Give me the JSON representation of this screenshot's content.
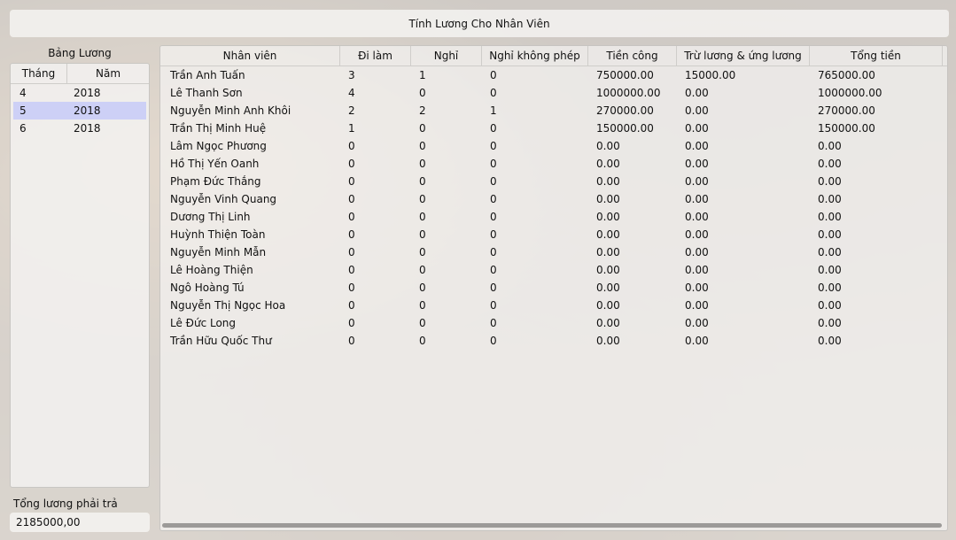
{
  "window": {
    "title": "Tính Lương Cho Nhân Viên"
  },
  "left": {
    "title": "Bảng Lương",
    "headers": {
      "month": "Tháng",
      "year": "Năm"
    },
    "rows": [
      {
        "month": "4",
        "year": "2018"
      },
      {
        "month": "5",
        "year": "2018"
      },
      {
        "month": "6",
        "year": "2018"
      }
    ],
    "selected_index": 1,
    "total_label": "Tổng lương phải trả",
    "total_value": "2185000,00"
  },
  "grid": {
    "headers": [
      "Nhân viên",
      "Đi làm",
      "Nghỉ",
      "Nghỉ không phép",
      "Tiền công",
      "Trừ lương & ứng lương",
      "Tổng tiền"
    ],
    "rows": [
      [
        "Trần Anh Tuấn",
        "3",
        "1",
        "0",
        "750000.00",
        "15000.00",
        "765000.00"
      ],
      [
        "Lê Thanh Sơn",
        "4",
        "0",
        "0",
        "1000000.00",
        "0.00",
        "1000000.00"
      ],
      [
        "Nguyễn Minh Anh Khôi",
        "2",
        "2",
        "1",
        "270000.00",
        "0.00",
        "270000.00"
      ],
      [
        "Trần Thị Minh Huệ",
        "1",
        "0",
        "0",
        "150000.00",
        "0.00",
        "150000.00"
      ],
      [
        "Lâm Ngọc Phương",
        "0",
        "0",
        "0",
        "0.00",
        "0.00",
        "0.00"
      ],
      [
        "Hồ Thị Yến Oanh",
        "0",
        "0",
        "0",
        "0.00",
        "0.00",
        "0.00"
      ],
      [
        "Phạm Đức Thắng",
        "0",
        "0",
        "0",
        "0.00",
        "0.00",
        "0.00"
      ],
      [
        "Nguyễn Vinh Quang",
        "0",
        "0",
        "0",
        "0.00",
        "0.00",
        "0.00"
      ],
      [
        "Dương Thị Linh",
        "0",
        "0",
        "0",
        "0.00",
        "0.00",
        "0.00"
      ],
      [
        "Huỳnh Thiện Toàn",
        "0",
        "0",
        "0",
        "0.00",
        "0.00",
        "0.00"
      ],
      [
        "Nguyễn Minh Mẫn",
        "0",
        "0",
        "0",
        "0.00",
        "0.00",
        "0.00"
      ],
      [
        "Lê Hoàng Thiện",
        "0",
        "0",
        "0",
        "0.00",
        "0.00",
        "0.00"
      ],
      [
        "Ngô Hoàng Tú",
        "0",
        "0",
        "0",
        "0.00",
        "0.00",
        "0.00"
      ],
      [
        "Nguyễn Thị Ngọc Hoa",
        "0",
        "0",
        "0",
        "0.00",
        "0.00",
        "0.00"
      ],
      [
        "Lê Đức Long",
        "0",
        "0",
        "0",
        "0.00",
        "0.00",
        "0.00"
      ],
      [
        "Trần Hữu Quốc Thư",
        "0",
        "0",
        "0",
        "0.00",
        "0.00",
        "0.00"
      ]
    ]
  }
}
